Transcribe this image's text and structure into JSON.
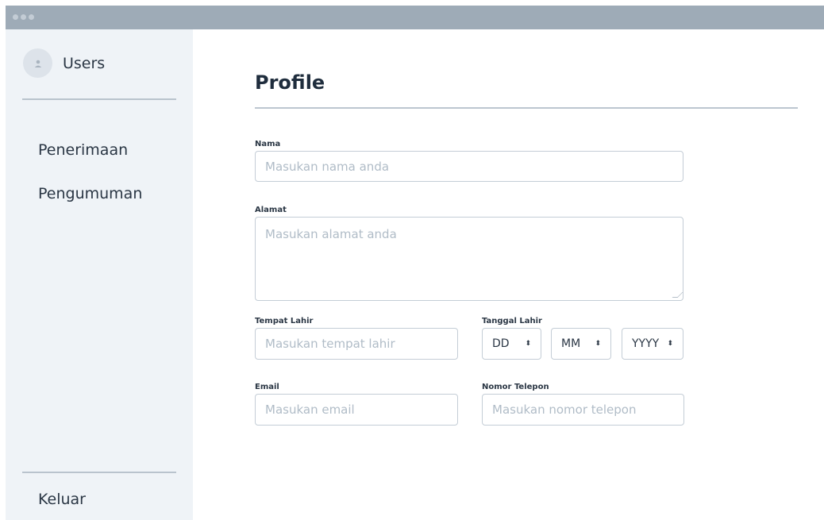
{
  "sidebar": {
    "user_label": "Users",
    "nav": [
      "Penerimaan",
      "Pengumuman"
    ],
    "logout_label": "Keluar"
  },
  "main": {
    "title": "Profile"
  },
  "form": {
    "nama": {
      "label": "Nama",
      "placeholder": "Masukan nama anda"
    },
    "alamat": {
      "label": "Alamat",
      "placeholder": "Masukan alamat anda"
    },
    "tempat_lahir": {
      "label": "Tempat Lahir",
      "placeholder": "Masukan tempat lahir"
    },
    "tanggal_lahir": {
      "label": "Tanggal Lahir",
      "day": "DD",
      "month": "MM",
      "year": "YYYY"
    },
    "email": {
      "label": "Email",
      "placeholder": "Masukan email"
    },
    "telepon": {
      "label": "Nomor Telepon",
      "placeholder": "Masukan nomor telepon"
    }
  },
  "icons": {
    "avatar": "user-icon",
    "select_chevron": "updown-chevron-icon"
  },
  "colors": {
    "titlebar": "#9eabb7",
    "sidebar": "#eff3f7",
    "border": "#c4cdd6",
    "placeholder": "#b0bcc7"
  }
}
